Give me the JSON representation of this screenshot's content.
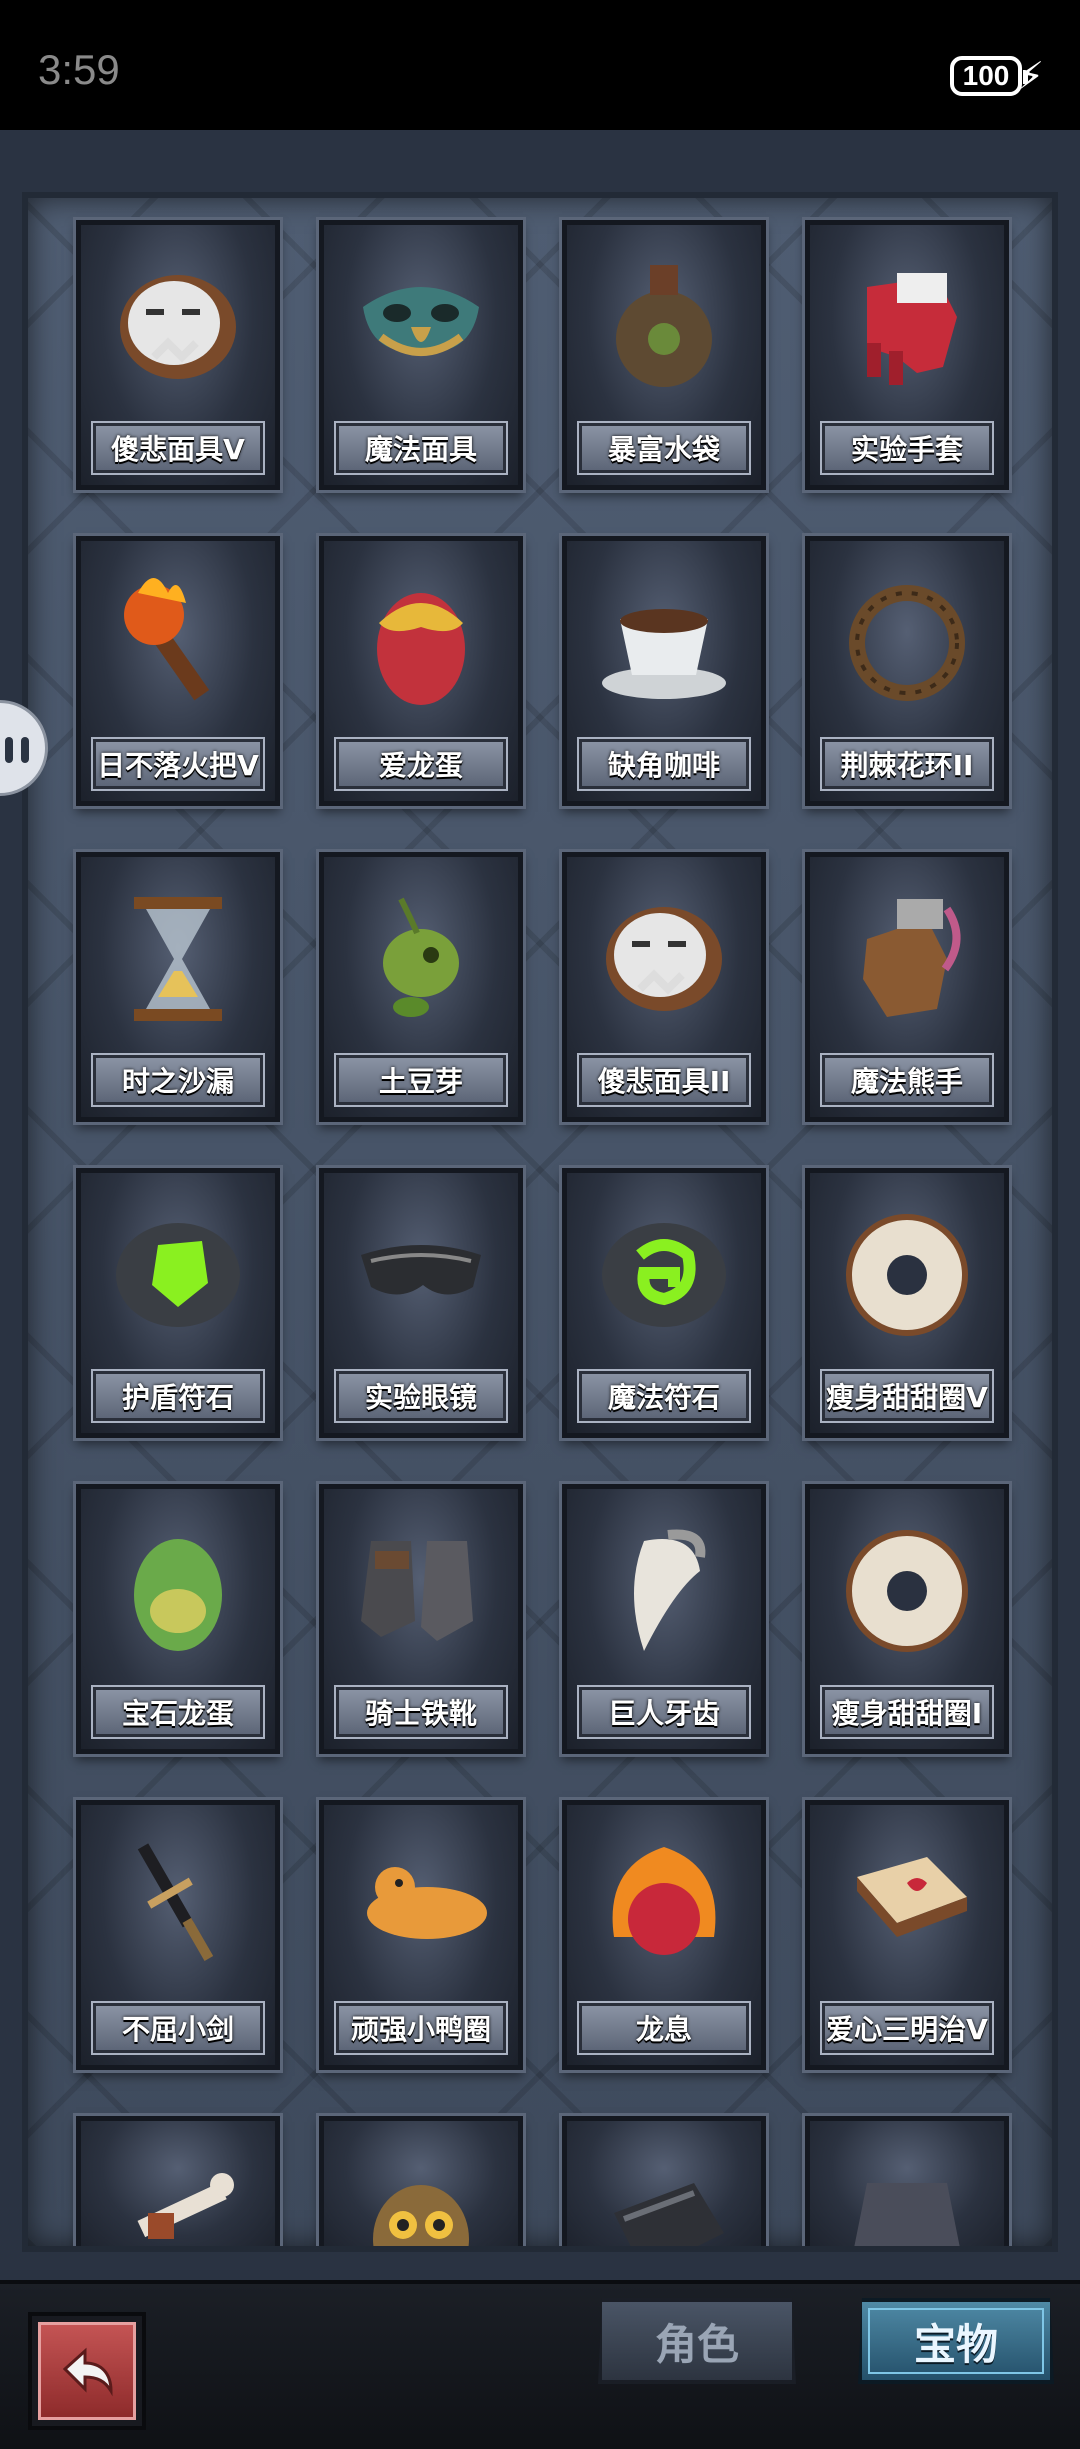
{
  "status_bar": {
    "time": "3:59",
    "battery": "100"
  },
  "items": [
    {
      "name": "傻悲面具V",
      "icon": "sad-mask-icon"
    },
    {
      "name": "魔法面具",
      "icon": "magic-mask-icon"
    },
    {
      "name": "暴富水袋",
      "icon": "water-pouch-icon"
    },
    {
      "name": "实验手套",
      "icon": "lab-glove-icon"
    },
    {
      "name": "日不落火把V",
      "icon": "torch-icon"
    },
    {
      "name": "爱龙蛋",
      "icon": "dragon-egg-icon"
    },
    {
      "name": "缺角咖啡",
      "icon": "coffee-cup-icon"
    },
    {
      "name": "荆棘花环II",
      "icon": "thorn-wreath-icon"
    },
    {
      "name": "时之沙漏",
      "icon": "hourglass-icon"
    },
    {
      "name": "土豆芽",
      "icon": "potato-sprout-icon"
    },
    {
      "name": "傻悲面具II",
      "icon": "sad-mask-icon"
    },
    {
      "name": "魔法熊手",
      "icon": "bear-paw-icon"
    },
    {
      "name": "护盾符石",
      "icon": "shield-rune-icon"
    },
    {
      "name": "实验眼镜",
      "icon": "lab-goggles-icon"
    },
    {
      "name": "魔法符石",
      "icon": "magic-rune-icon"
    },
    {
      "name": "瘦身甜甜圈V",
      "icon": "donut-icon"
    },
    {
      "name": "宝石龙蛋",
      "icon": "gem-egg-icon"
    },
    {
      "name": "骑士铁靴",
      "icon": "knight-boots-icon"
    },
    {
      "name": "巨人牙齿",
      "icon": "giant-tooth-icon"
    },
    {
      "name": "瘦身甜甜圈I",
      "icon": "donut-icon"
    },
    {
      "name": "不屈小剑",
      "icon": "short-sword-icon"
    },
    {
      "name": "顽强小鸭圈",
      "icon": "duck-ring-icon"
    },
    {
      "name": "龙息",
      "icon": "dragon-breath-icon"
    },
    {
      "name": "爱心三明治V",
      "icon": "sandwich-icon"
    }
  ],
  "partial_items": [
    {
      "icon": "bone-icon"
    },
    {
      "icon": "owl-icon"
    },
    {
      "icon": "armor-gauntlet-icon"
    },
    {
      "icon": "hooded-cloak-icon"
    }
  ],
  "bottom_bar": {
    "back_icon": "back-arrow-icon",
    "tab_role": "角色",
    "tab_treasure": "宝物"
  }
}
